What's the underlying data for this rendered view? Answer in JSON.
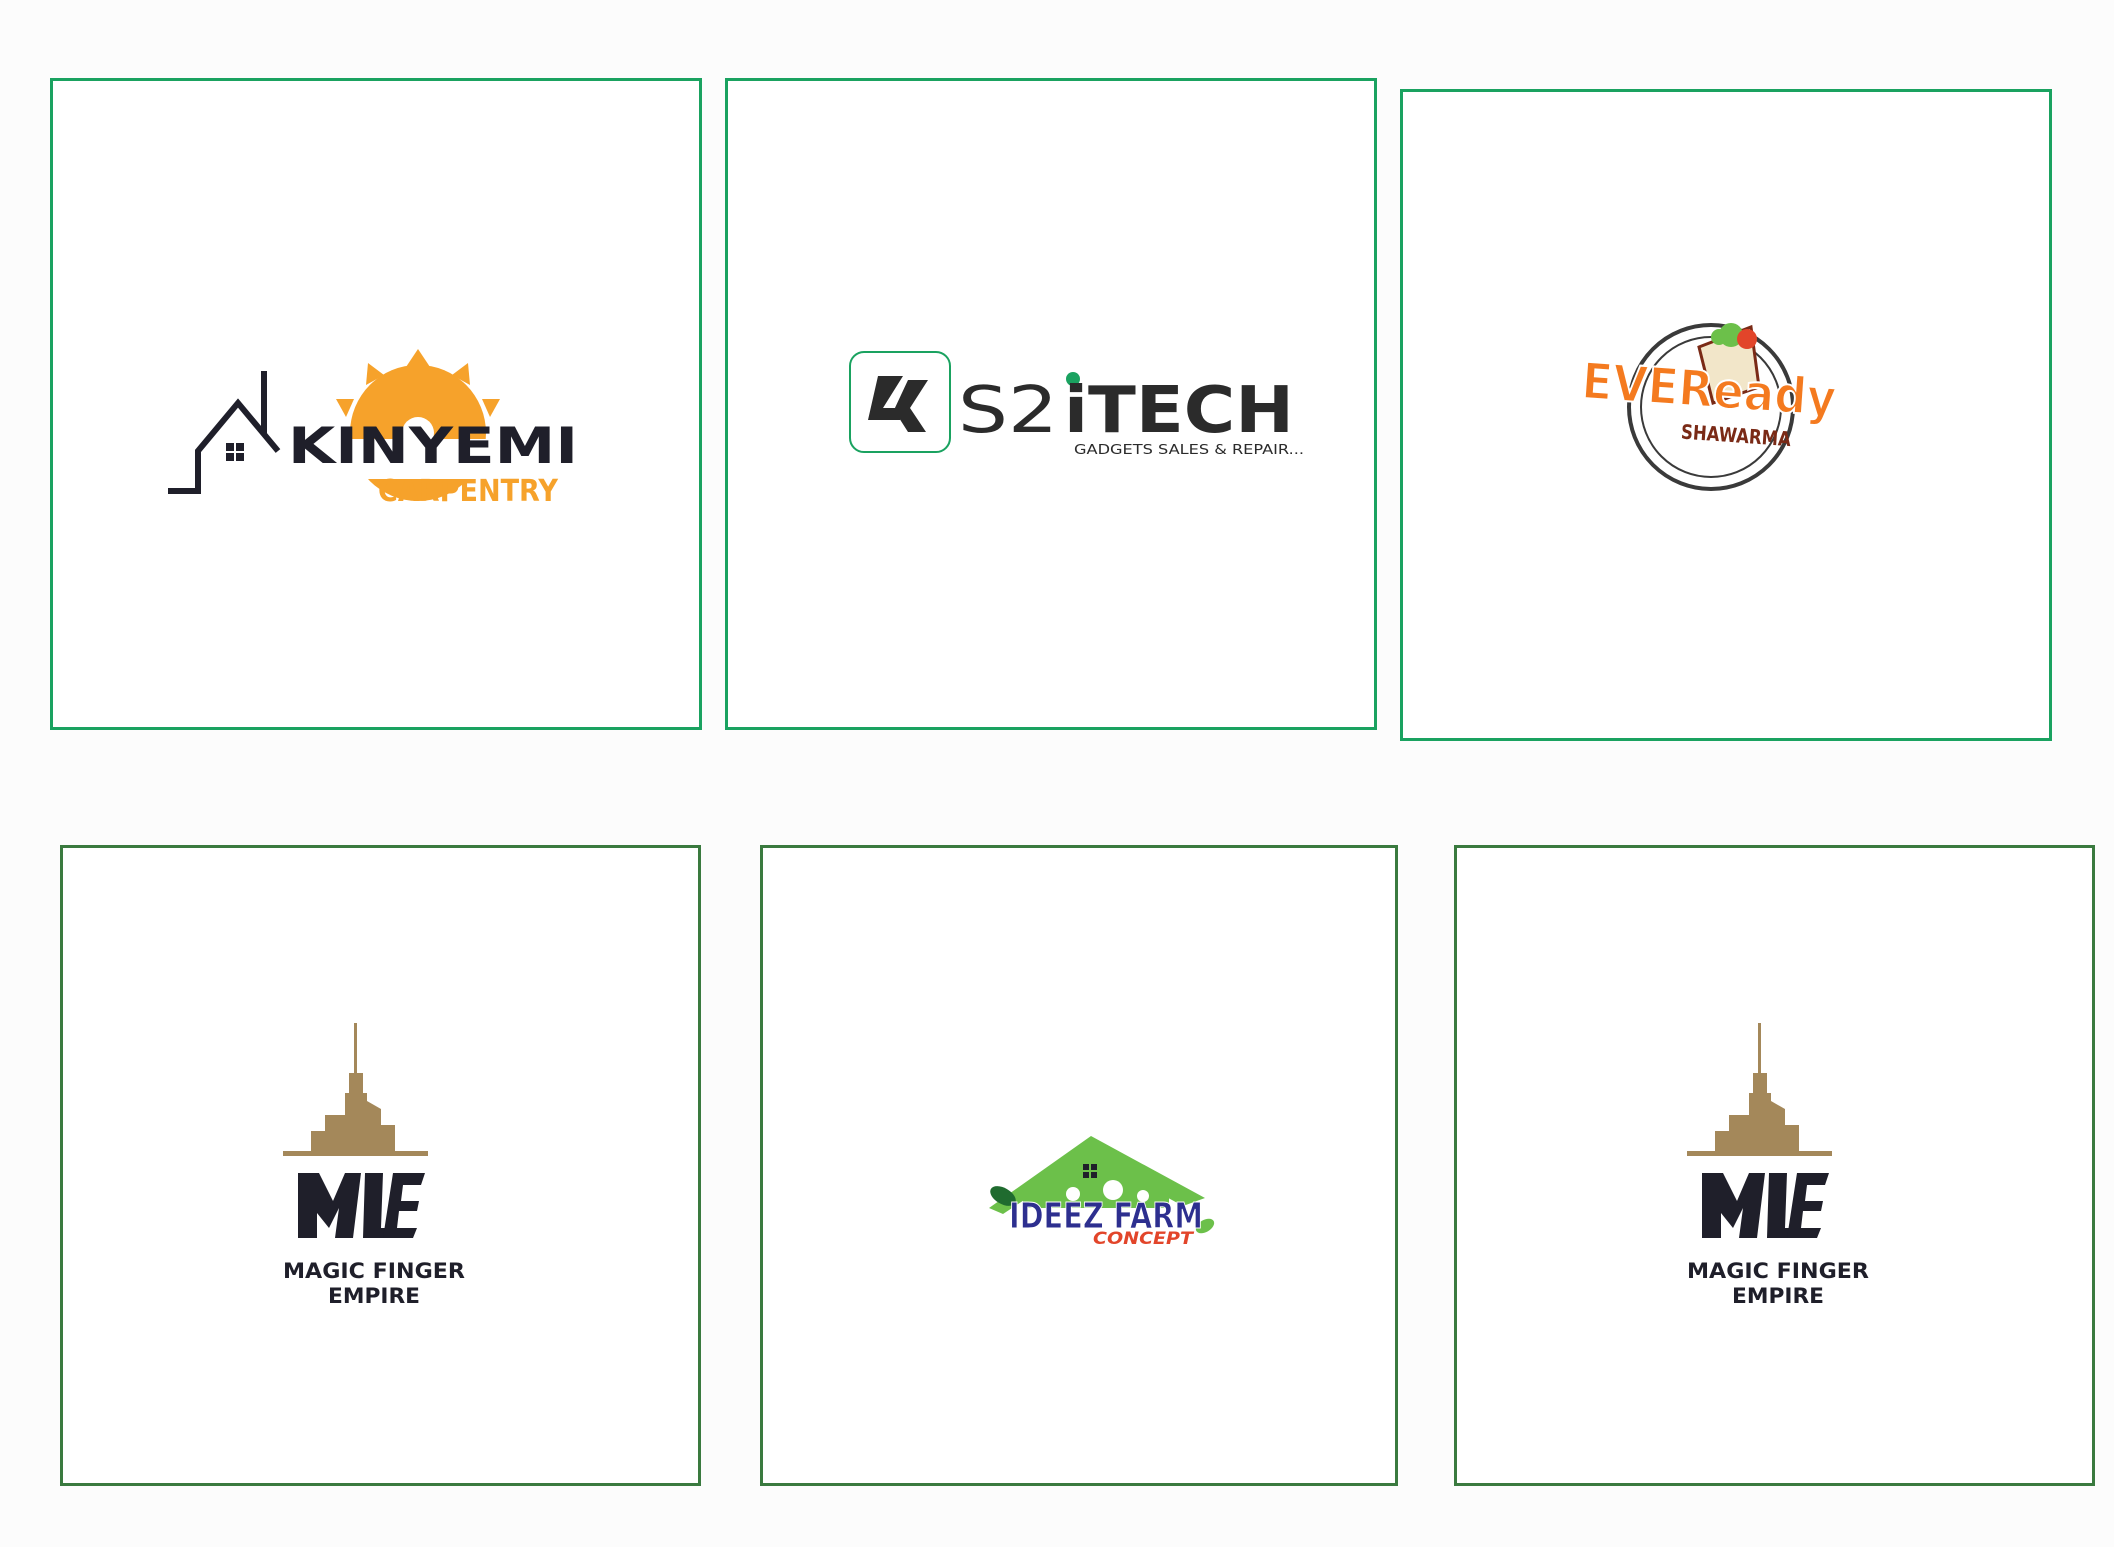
{
  "colors": {
    "card_border_top": "#1aa260",
    "card_border_bottom": "#3a7a3f",
    "akinyemi_orange": "#f6a22b",
    "ink": "#1f1f2a",
    "s2itech_green": "#1aa260",
    "eveready_orange": "#f47a1f",
    "eveready_brown": "#7a2a16",
    "mfe_gold": "#a4885a",
    "ideez_green": "#6cc04a",
    "ideez_blue": "#2d2f8f",
    "ideez_red": "#e2452a"
  },
  "logos": [
    {
      "id": "akinyemi",
      "line1": "KINYEMI",
      "line2": "CARPENTRY"
    },
    {
      "id": "s2itech",
      "line1": "S2",
      "line2": "iTECH",
      "tagline": "GADGETS SALES & REPAIR..."
    },
    {
      "id": "eveready",
      "line1": "EVEReady",
      "line2": "SHAWARMA"
    },
    {
      "id": "mfe_left",
      "line1": "MAGIC FINGER",
      "line2": "EMPIRE"
    },
    {
      "id": "ideez",
      "line1": "IDEEZ FARM",
      "line2": "CONCEPT"
    },
    {
      "id": "mfe_right",
      "line1": "MAGIC FINGER",
      "line2": "EMPIRE"
    }
  ]
}
